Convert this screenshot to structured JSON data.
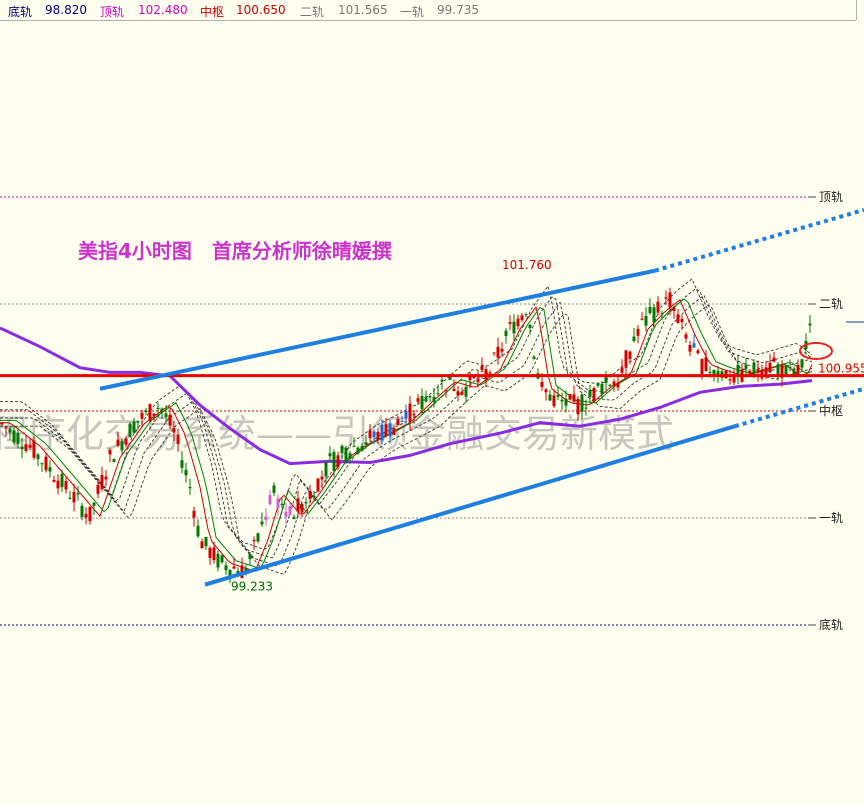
{
  "header": {
    "items": [
      {
        "label": "底轨",
        "value": "98.820",
        "color": "#000080"
      },
      {
        "label": "顶轨",
        "value": "102.480",
        "color": "#cc00cc"
      },
      {
        "label": "中枢",
        "value": "100.650",
        "color": "#cc0000"
      },
      {
        "label": "二轨",
        "value": "101.565",
        "color": "#777777"
      },
      {
        "label": "一轨",
        "value": "99.735",
        "color": "#777777"
      }
    ]
  },
  "chart_data": {
    "type": "candlestick",
    "title": "美指4小时图　首席分析师徐晴媛撰",
    "watermark": "程序化交易系统——引领金融交易新模式",
    "ylim": [
      98.55,
      103.0
    ],
    "levels": [
      {
        "name": "顶轨",
        "value": 102.48,
        "color": "#cc00cc",
        "style": "dotted"
      },
      {
        "name": "二轨",
        "value": 101.565,
        "color": "#888888",
        "style": "dotted"
      },
      {
        "name": "中枢",
        "value": 100.65,
        "color": "#cc0000",
        "style": "dotted"
      },
      {
        "name": "一轨",
        "value": 99.735,
        "color": "#888888",
        "style": "dotted"
      },
      {
        "name": "底轨",
        "value": 98.82,
        "color": "#000080",
        "style": "dotted"
      }
    ],
    "support_resistance": {
      "value": 100.953,
      "color": "#ee0000"
    },
    "price_tag": "100.955",
    "annotations": [
      {
        "text": "101.760",
        "value": 101.76,
        "color": "#cc0000",
        "type": "high"
      },
      {
        "text": "99.233",
        "value": 99.233,
        "color": "#006600",
        "type": "low"
      }
    ],
    "channel": {
      "upper": {
        "from_value": 100.84,
        "to_value": 102.37
      },
      "lower": {
        "from_value": 99.165,
        "to_value": 100.84
      },
      "color": "#1e7fe0"
    },
    "series": [
      {
        "name": "",
        "color": "#8a2be2",
        "style": "thick"
      },
      {
        "name": "",
        "color": "#cc0000",
        "style": "thin"
      },
      {
        "name": "",
        "color": "#008000",
        "style": "thin"
      }
    ]
  }
}
